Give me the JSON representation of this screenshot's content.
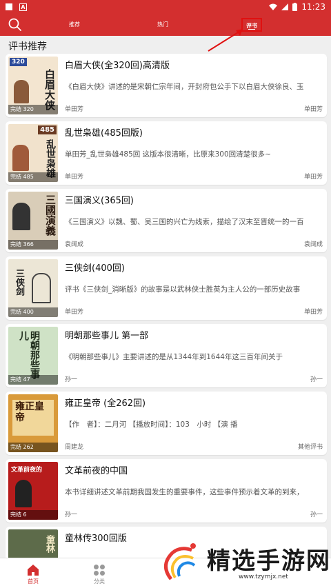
{
  "status_bar": {
    "time": "11:23"
  },
  "header": {
    "tabs": [
      {
        "label": "推荐"
      },
      {
        "label": "热门"
      },
      {
        "label": "评书"
      }
    ]
  },
  "section_title": "评书推荐",
  "books": [
    {
      "title": "白眉大侠(全320回)高清版",
      "desc": "《白眉大侠》讲述的是宋朝仁宗年间，开封府包公手下以白眉大侠徐良、玉",
      "author": "单田芳",
      "tag": "单田芳",
      "badge": "完结 320",
      "cover_text": "白眉大侠",
      "cover_label": "320",
      "cover_color": "#f3e5d0"
    },
    {
      "title": "乱世枭雄(485回版)",
      "desc": "单田芳_乱世枭雄485回 这版本很清晰，比原来300回清楚很多~",
      "author": "单田芳",
      "tag": "单田芳",
      "badge": "完结 485",
      "cover_text": "乱世枭雄",
      "cover_label": "485",
      "cover_color": "#f1e2cc"
    },
    {
      "title": "三国演义(365回)",
      "desc": "《三国演义》以魏、蜀、吴三国的兴亡为线索，描绘了汉末至晋统一的一百",
      "author": "袁阔成",
      "tag": "袁阔成",
      "badge": "完结 366",
      "cover_text": "三國演義",
      "cover_label": "",
      "cover_color": "#d9cdb8"
    },
    {
      "title": "三侠剑(400回)",
      "desc": "评书《三侠剑_消晰版》的故事是以武林侠士胜英为主人公的一部历史故事",
      "author": "单田芳",
      "tag": "单田芳",
      "badge": "完结 400",
      "cover_text": "三侠剑",
      "cover_label": "",
      "cover_color": "#ece6d6"
    },
    {
      "title": "明朝那些事儿 第一部",
      "desc": "《明朝那些事儿》主要讲述的是从1344年到1644年这三百年间关于",
      "author": "孙一",
      "tag": "孙一",
      "badge": "完结 47",
      "cover_text": "明朝那些事儿",
      "cover_label": "",
      "cover_color": "#cfe2c6"
    },
    {
      "title": "雍正皇帝 (全262回)",
      "desc": "【作　者】：二月河 【播放时间】：103　小时 【演 播",
      "author": "周建龙",
      "tag": "其他评书",
      "badge": "完结 262",
      "cover_text": "雍正皇帝",
      "cover_label": "",
      "cover_color": "#d99a3a"
    },
    {
      "title": "文革前夜的中国",
      "desc": "本书详细讲述文革前期我国发生的重要事件，这些事件预示着文革的到来，",
      "author": "孙一",
      "tag": "孙一",
      "badge": "完结 6",
      "cover_text": "文革前夜的",
      "cover_label": "",
      "cover_color": "#b71c1c"
    },
    {
      "title": "童林传300回版",
      "desc": "",
      "author": "",
      "tag": "",
      "badge": "",
      "cover_text": "童林",
      "cover_label": "",
      "cover_color": "#5d6b4a"
    }
  ],
  "bottom_nav": [
    {
      "label": "首页"
    },
    {
      "label": "分类"
    }
  ],
  "watermark": {
    "text": "精选手游网",
    "url": "www.tzymjx.net"
  },
  "colors": {
    "brand_red": "#d32f2f",
    "background": "#efefef"
  }
}
